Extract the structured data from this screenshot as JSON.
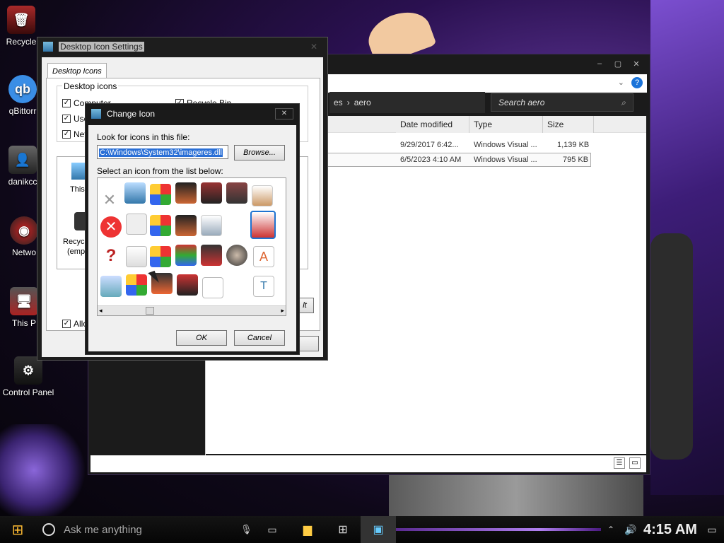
{
  "desktop": {
    "icons": [
      {
        "label": "Recycle"
      },
      {
        "label": "qBittorr"
      },
      {
        "label": "danikcc"
      },
      {
        "label": "Netwo"
      },
      {
        "label": "This P"
      },
      {
        "label": "Control Panel"
      }
    ],
    "qbit_glyph": "qb"
  },
  "explorer": {
    "breadcrumb_prefix": "es",
    "breadcrumb_sep": "›",
    "breadcrumb_current": "aero",
    "search_placeholder": "Search aero",
    "columns": {
      "date": "Date modified",
      "type": "Type",
      "size": "Size"
    },
    "rows": [
      {
        "date": "9/29/2017 6:42...",
        "type": "Windows Visual ...",
        "size": "1,139 KB"
      },
      {
        "date": "6/5/2023 4:10 AM",
        "type": "Windows Visual ...",
        "size": "795 KB"
      }
    ],
    "help_glyph": "?"
  },
  "desktop_icon_settings": {
    "title": "Desktop Icon Settings",
    "tab": "Desktop Icons",
    "group_label": "Desktop icons",
    "checks": {
      "computer": "Computer",
      "user": "Use",
      "network": "Net",
      "recycle": "Recycle Bin"
    },
    "preview_labels": {
      "this": "This",
      "recycle": "Recyc",
      "empty": "(emp"
    },
    "allow_label": "Allow",
    "restore_fragment": "lt",
    "close": "✕"
  },
  "change_icon": {
    "title": "Change Icon",
    "look_label": "Look for icons in this file:",
    "file_path": "C:\\Windows\\System32\\imageres.dll",
    "browse": "Browse...",
    "select_label": "Select an icon from the list below:",
    "ok": "OK",
    "cancel": "Cancel",
    "close": "✕"
  },
  "taskbar": {
    "search_placeholder": "Ask me anything",
    "clock": "4:15 AM"
  }
}
